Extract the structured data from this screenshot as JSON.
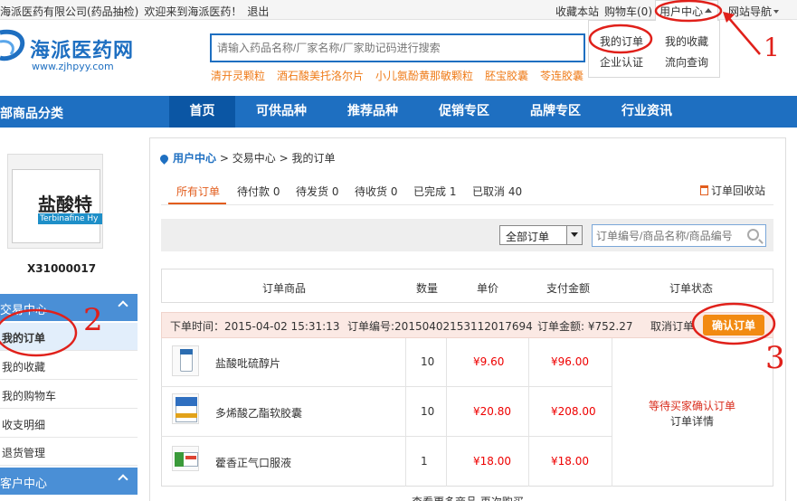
{
  "topbar": {
    "company": "海派医药有限公司(药品抽检)",
    "welcome": "欢迎来到海派医药！",
    "logout": "退出",
    "bookmark": "收藏本站",
    "cart": "购物车(0)",
    "user_center": "用户中心",
    "site_nav": "网站导航"
  },
  "dropdown": {
    "my_orders": "我的订单",
    "my_favorites": "我的收藏",
    "enterprise_auth": "企业认证",
    "flow_query": "流向查询"
  },
  "header": {
    "logo_name": "海派医药网",
    "logo_url": "www.zjhpyy.com",
    "search_placeholder": "请输入药品名称/厂家名称/厂家助记码进行搜索",
    "hot_keywords": [
      "清开灵颗粒",
      "酒石酸美托洛尔片",
      "小儿氨酚黄那敏颗粒",
      "胚宝胶囊",
      "苓连胶囊"
    ]
  },
  "nav": {
    "all_categories": "部商品分类",
    "items": [
      "首页",
      "可供品种",
      "推荐品种",
      "促销专区",
      "品牌专区",
      "行业资讯"
    ]
  },
  "sidebar": {
    "product_text_zh": "盐酸特",
    "product_text_en": "Terbinafine Hy",
    "product_code": "X31000017",
    "trade_center": "交易中心",
    "trade_items": [
      "我的订单",
      "我的收藏",
      "我的购物车",
      "收支明细",
      "退货管理"
    ],
    "account_center": "客户中心"
  },
  "breadcrumb": {
    "user_center": "用户中心",
    "sep": ">",
    "trade_center": "交易中心",
    "my_orders": "我的订单"
  },
  "tabs": [
    "所有订单",
    "待付款 0",
    "待发货 0",
    "待收货 0",
    "已完成 1",
    "已取消 40"
  ],
  "recycle_bin": "订单回收站",
  "filter": {
    "select_value": "全部订单",
    "search_placeholder": "订单编号/商品名称/商品编号"
  },
  "table_headers": [
    "订单商品",
    "数量",
    "单价",
    "支付金额",
    "订单状态"
  ],
  "order": {
    "time_label": "下单时间：2015-04-02 15:31:13",
    "number_label": "订单编号:20150402153112017694",
    "amount_label": "订单金额: ¥752.27",
    "cancel": "取消订单",
    "confirm": "确认订单",
    "items": [
      {
        "name": "盐酸吡硫醇片",
        "qty": "10",
        "price": "¥9.60",
        "total": "¥96.00"
      },
      {
        "name": "多烯酸乙酯软胶囊",
        "qty": "10",
        "price": "¥20.80",
        "total": "¥208.00"
      },
      {
        "name": "藿香正气口服液",
        "qty": "1",
        "price": "¥18.00",
        "total": "¥18.00"
      }
    ],
    "status": "等待买家确认订单",
    "detail": "订单详情",
    "more": "查看更多商品   再次购买"
  },
  "annotations": [
    "1",
    "2",
    "3"
  ],
  "colors": {
    "brand_blue": "#1e6fc1",
    "nav_active": "#0b56a4",
    "orange": "#ef7c1a",
    "confirm": "#f28a12",
    "price_red": "#e00",
    "annotation_red": "#e0201a"
  }
}
